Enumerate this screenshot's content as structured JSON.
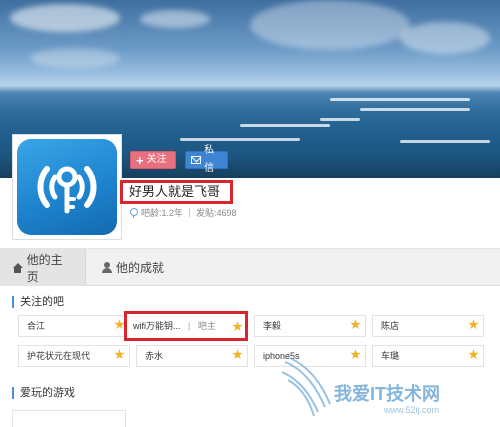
{
  "profile": {
    "username": "好男人就是飞哥",
    "meta_age": "吧龄:1.2年",
    "meta_posts": "发贴:4698",
    "follow_label": "关注",
    "message_label": "私信"
  },
  "tabs": {
    "home": "他的主页",
    "achievements": "他的成就"
  },
  "followed_bars": {
    "title": "关注的吧",
    "items": [
      {
        "name": "合江"
      },
      {
        "name": "wifi万能钥...",
        "tag": "吧主"
      },
      {
        "name": "李毅"
      },
      {
        "name": "陈店"
      },
      {
        "name": "护花状元在现代"
      },
      {
        "name": "赤水"
      },
      {
        "name": "iphone5s"
      },
      {
        "name": "车璐"
      }
    ]
  },
  "games": {
    "title": "爱玩的游戏"
  },
  "watermark": {
    "text": "我爱IT技术网",
    "url": "www.52ij.com"
  },
  "colors": {
    "follow_button": "#e9707f",
    "message_button": "#3e86d4",
    "highlight_red": "#d9252c",
    "star": "#f0b323",
    "accent_blue": "#4a90d9"
  }
}
